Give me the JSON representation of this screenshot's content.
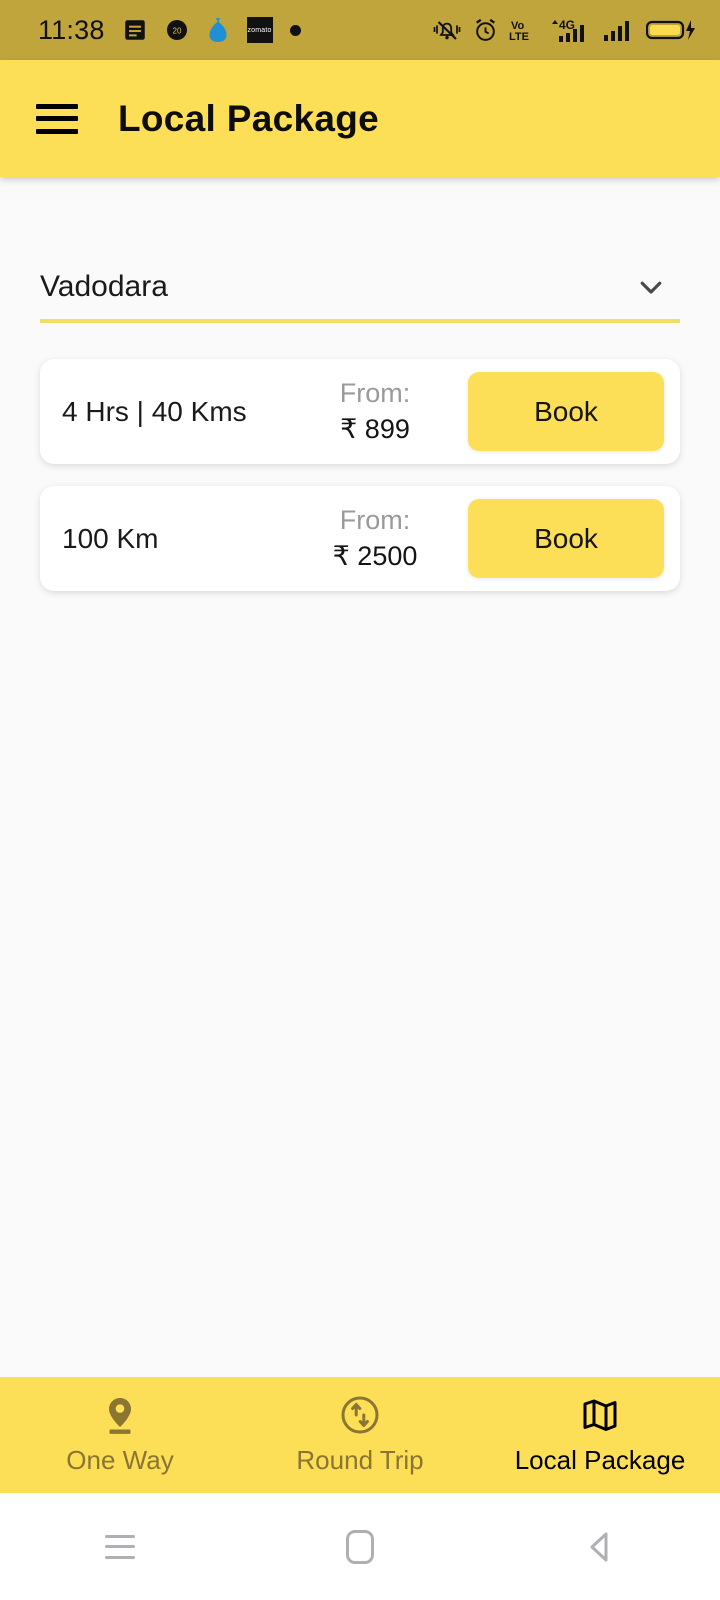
{
  "status_bar": {
    "time": "11:38",
    "left_icons": [
      "message-icon",
      "circle-badge-icon",
      "money-bag-icon",
      "zomato-icon",
      "dot-icon"
    ],
    "zomato_label": "zomato",
    "right_icons": [
      "vibrate-mute-icon",
      "alarm-clock-icon",
      "volte-icon",
      "signal-4g-icon",
      "signal-bars-icon",
      "battery-charging-icon"
    ],
    "volte_top": "Vo",
    "volte_bottom": "LTE",
    "network_label": "4G",
    "background_color": "#bfa53c"
  },
  "app_bar": {
    "menu_icon": "hamburger-menu-icon",
    "title": "Local Package",
    "background_color": "#fcdf57"
  },
  "city_selector": {
    "value": "Vadodara",
    "icon": "chevron-down-icon",
    "underline_color": "#f5dd63"
  },
  "packages": [
    {
      "duration": "4 Hrs | 40 Kms",
      "from_label": "From:",
      "price": "₹ 899",
      "book_label": "Book"
    },
    {
      "duration": "100 Km",
      "from_label": "From:",
      "price": "₹ 2500",
      "book_label": "Book"
    }
  ],
  "bottom_nav": {
    "items": [
      {
        "label": "One Way",
        "icon": "location-pin-icon",
        "active": false
      },
      {
        "label": "Round Trip",
        "icon": "round-trip-arrows-icon",
        "active": false
      },
      {
        "label": "Local Package",
        "icon": "map-icon",
        "active": true
      }
    ],
    "background_color": "#fcdf57",
    "inactive_color": "#8a7531",
    "active_color": "#000000"
  },
  "android_nav": {
    "buttons": [
      "recents-icon",
      "home-icon",
      "back-icon"
    ]
  }
}
